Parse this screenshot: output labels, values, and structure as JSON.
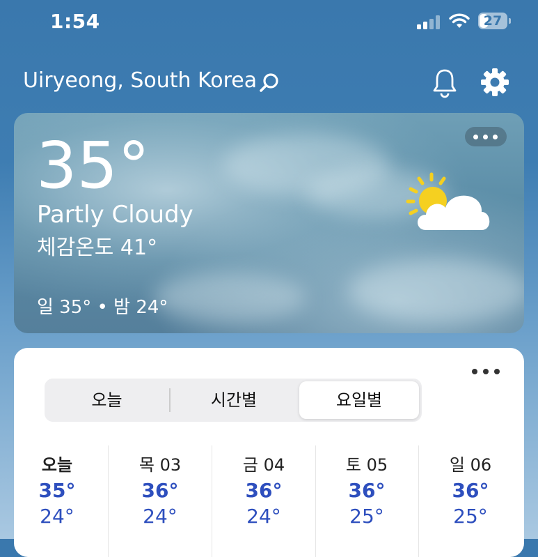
{
  "status_bar": {
    "time": "1:54",
    "battery": "27"
  },
  "header": {
    "location": "Uiryeong, South Korea"
  },
  "current": {
    "temperature": "35°",
    "condition": "Partly Cloudy",
    "feels_like": "체감온도 41°",
    "high_low": "일 35° • 밤 24°"
  },
  "tabs": [
    {
      "label": "오늘",
      "active": false
    },
    {
      "label": "시간별",
      "active": false
    },
    {
      "label": "요일별",
      "active": true
    }
  ],
  "days": [
    {
      "label": "오늘",
      "high": "35°",
      "low": "24°"
    },
    {
      "label": "목 03",
      "high": "36°",
      "low": "24°"
    },
    {
      "label": "금 04",
      "high": "36°",
      "low": "24°"
    },
    {
      "label": "토 05",
      "high": "36°",
      "low": "25°"
    },
    {
      "label": "일 06",
      "high": "36°",
      "low": "25°"
    }
  ],
  "colors": {
    "accent": "#2e4fbe",
    "sky": "#3a78ad",
    "sun": "#f5d020"
  }
}
